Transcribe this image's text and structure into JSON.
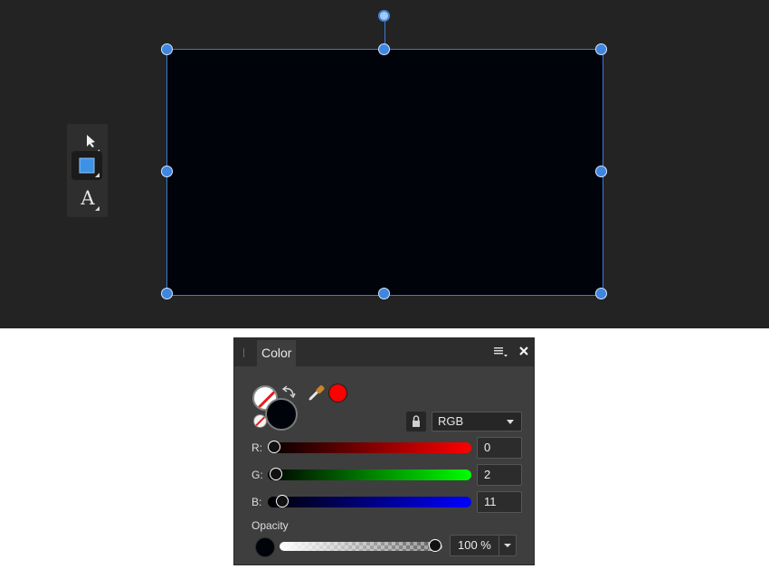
{
  "tools": {
    "move": "move-tool-icon",
    "rectangle": "rectangle-tool-icon",
    "text": "text-tool-icon",
    "text_glyph": "A"
  },
  "shape": {
    "fill": "#01030b",
    "selection_color": "#3d7ad6"
  },
  "color_panel": {
    "tab_label": "Color",
    "model": "RGB",
    "picked_color": "#ff0000",
    "channels": [
      {
        "label": "R:",
        "value": "0",
        "fraction": 0.0
      },
      {
        "label": "G:",
        "value": "2",
        "fraction": 0.008
      },
      {
        "label": "B:",
        "value": "11",
        "fraction": 0.043
      }
    ],
    "opacity_label": "Opacity",
    "opacity_value": "100 %",
    "opacity_fraction": 1.0
  }
}
